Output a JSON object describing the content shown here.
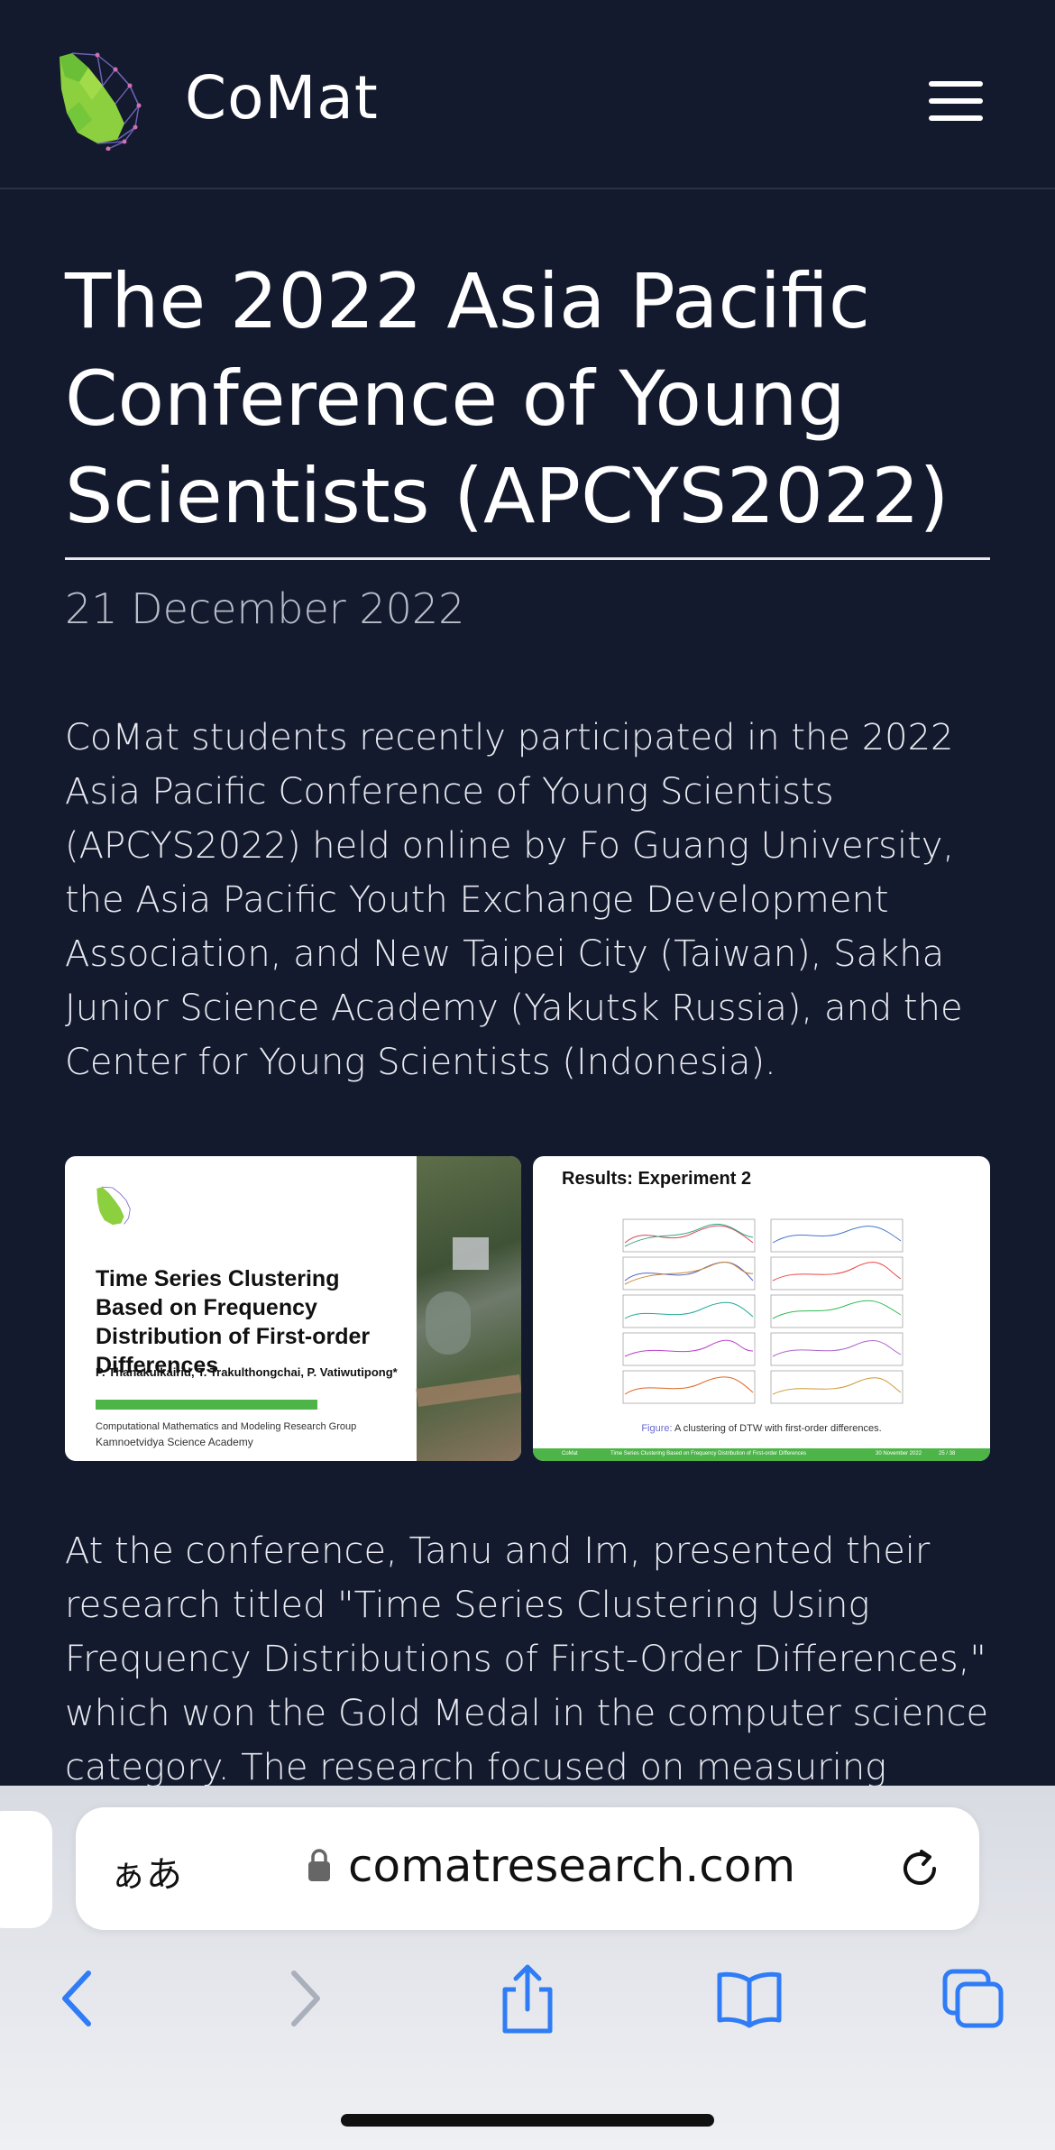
{
  "header": {
    "brand": "CoMat",
    "logo_icon": "comat-leaf-network-logo",
    "menu_icon": "hamburger-menu-icon"
  },
  "article": {
    "title": "The 2022 Asia Pacific Conference of Young Scientists (APCYS2022)",
    "date": "21 December 2022",
    "paragraph1": "CoMat students recently participated in the 2022 Asia Pacific Conference of Young Scientists (APCYS2022) held online by Fo Guang University, the Asia Pacific Youth Exchange Development Association, and New Taipei City (Taiwan), Sakha Junior Science Academy (Yakutsk Russia), and the Center for Young Scientists (Indonesia).",
    "paragraph2": "At the conference, Tanu and Im, presented their research titled \"Time Series Clustering Using Frequency Distributions of First-Order Differences,\" which won the Gold Medal in the computer science category. The research focused on measuring"
  },
  "slide1": {
    "title": "Time Series Clustering Based on Frequency Distribution of First-order Differences",
    "authors": "P. Thanakulkairid, T. Trakulthongchai, P. Vatiwutipong*",
    "group": "Computational Mathematics and Modeling Research Group",
    "academy": "Kamnoetvidya Science Academy"
  },
  "slide2": {
    "title": "Results: Experiment 2",
    "caption_prefix": "Figure:",
    "caption": "A clustering of DTW with first-order differences.",
    "footer_left": "CoMat",
    "footer_mid": "Time Series Clustering Based on Frequency Distribution of First-order Differences",
    "footer_date": "30 November 2022",
    "footer_page": "25 / 38"
  },
  "browser": {
    "aa_label": "ぁあ",
    "url": "comatresearch.com",
    "icons": [
      "back-chevron-icon",
      "forward-chevron-icon",
      "share-icon",
      "bookmarks-book-icon",
      "tabs-icon"
    ]
  },
  "colors": {
    "background": "#141a2e",
    "accent_green": "#4db548",
    "ios_blue": "#2f7cf6"
  }
}
